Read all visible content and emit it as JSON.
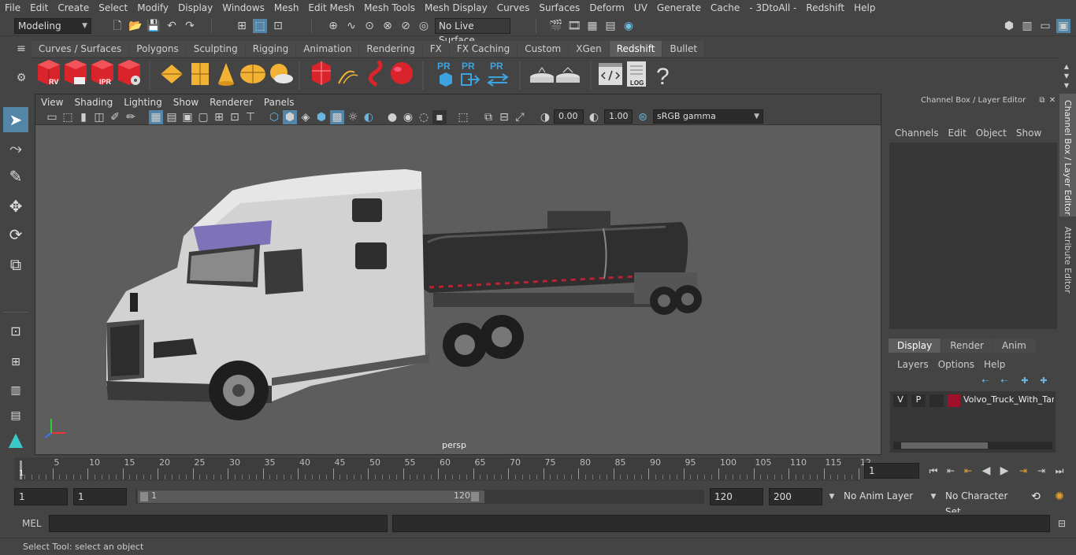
{
  "menu": [
    "File",
    "Edit",
    "Create",
    "Select",
    "Modify",
    "Display",
    "Windows",
    "Mesh",
    "Edit Mesh",
    "Mesh Tools",
    "Mesh Display",
    "Curves",
    "Surfaces",
    "Deform",
    "UV",
    "Generate",
    "Cache",
    "- 3DtoAll -",
    "Redshift",
    "Help"
  ],
  "status": {
    "mode": "Modeling",
    "live_surface": "No Live Surface"
  },
  "shelf_tabs": [
    {
      "label": "Curves / Surfaces",
      "active": false
    },
    {
      "label": "Polygons",
      "active": false
    },
    {
      "label": "Sculpting",
      "active": false
    },
    {
      "label": "Rigging",
      "active": false
    },
    {
      "label": "Animation",
      "active": false
    },
    {
      "label": "Rendering",
      "active": false
    },
    {
      "label": "FX",
      "active": false
    },
    {
      "label": "FX Caching",
      "active": false
    },
    {
      "label": "Custom",
      "active": false
    },
    {
      "label": "XGen",
      "active": false
    },
    {
      "label": "Redshift",
      "active": true
    },
    {
      "label": "Bullet",
      "active": false
    }
  ],
  "shelf_icons": {
    "rv": "RV",
    "ipr": "IPR",
    "pr1": "PR",
    "pr2": "PR",
    "pr3": "PR",
    "log": "LOG",
    "help": "?"
  },
  "viewport": {
    "menu": [
      "View",
      "Shading",
      "Lighting",
      "Show",
      "Renderer",
      "Panels"
    ],
    "exposure": "0.00",
    "gamma": "1.00",
    "colorspace": "sRGB gamma",
    "camera_label": "persp"
  },
  "channel_box": {
    "title": "Channel Box / Layer Editor",
    "menu": [
      "Channels",
      "Edit",
      "Object",
      "Show"
    ],
    "side_tabs": [
      "Channel Box / Layer Editor",
      "Attribute Editor"
    ]
  },
  "layer_editor": {
    "tabs": [
      {
        "label": "Display",
        "active": true
      },
      {
        "label": "Render",
        "active": false
      },
      {
        "label": "Anim",
        "active": false
      }
    ],
    "menu": [
      "Layers",
      "Options",
      "Help"
    ],
    "layers": [
      {
        "v": "V",
        "p": "P",
        "name": "Volvo_Truck_With_Tan",
        "color": "#a0102a"
      }
    ]
  },
  "timeline": {
    "ticks": [
      "5",
      "10",
      "15",
      "20",
      "25",
      "30",
      "35",
      "40",
      "45",
      "50",
      "55",
      "60",
      "65",
      "70",
      "75",
      "80",
      "85",
      "90",
      "95",
      "100",
      "105",
      "110",
      "115",
      "12"
    ],
    "start_marker": "1",
    "current_frame": "1"
  },
  "range": {
    "start": "1",
    "start2": "1",
    "slider_start": "1",
    "slider_end": "120",
    "end": "120",
    "end2": "200",
    "anim_layer": "No Anim Layer",
    "character_set": "No Character Set"
  },
  "command": {
    "label": "MEL"
  },
  "help_line": "Select Tool: select an object"
}
